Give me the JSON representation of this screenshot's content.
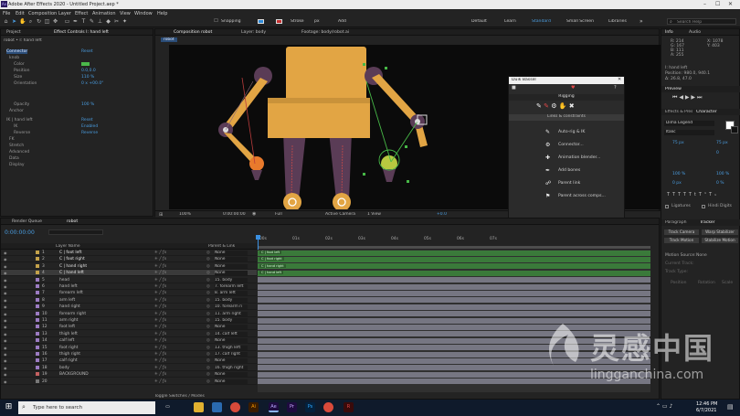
{
  "window": {
    "title": "Adobe After Effects 2020 - Untitled Project.aep *"
  },
  "menu": [
    "File",
    "Edit",
    "Composition",
    "Layer",
    "Effect",
    "Animation",
    "View",
    "Window",
    "Help"
  ],
  "toolbar": {
    "snapping": "Snapping",
    "stroke_label": "Stroke",
    "stroke_value": "px",
    "add_label": "Add",
    "workspaces": [
      "Default",
      "Learn",
      "Standard",
      "Small Screen",
      "Libraries"
    ],
    "search_placeholder": "Search Help"
  },
  "left_panel": {
    "tabs": [
      "Project",
      "Effect Controls I: hand left"
    ],
    "breadcrumb": "robot • I: hand left",
    "rows": [
      {
        "label": "Connector",
        "value": "Reset"
      },
      {
        "label": "knob",
        "value": ""
      },
      {
        "label": "Color",
        "value": ""
      },
      {
        "label": "Position",
        "value": "0.0,0.0"
      },
      {
        "label": "Size",
        "value": "110 %"
      },
      {
        "label": "Orientation",
        "value": "0 x +00.0°"
      },
      {
        "label": "Opacity",
        "value": "100 %"
      },
      {
        "label": "Anchor",
        "value": ""
      },
      {
        "label": "IK | hand left",
        "value": "Reset"
      },
      {
        "label": "IK",
        "value": "Enabled"
      },
      {
        "label": "Reverse",
        "value": "Reverse"
      },
      {
        "label": "FK",
        "value": ""
      },
      {
        "label": "Stretch",
        "value": ""
      },
      {
        "label": "Advanced",
        "value": ""
      },
      {
        "label": "Data",
        "value": ""
      },
      {
        "label": "Display",
        "value": ""
      }
    ]
  },
  "composition": {
    "tabs": [
      "Composition robot",
      "Layer: body",
      "Footage: body/robot.ai"
    ],
    "comp_name": "robot",
    "footer": {
      "zoom": "100%",
      "timecode": "0:00:00:00",
      "resolution": "Full",
      "camera": "Active Camera",
      "views": "1 View",
      "exposure": "+0.0"
    }
  },
  "duik": {
    "title": "Duik Bassel",
    "section": "Rigging",
    "subsection": "Links & constraints",
    "items": [
      "Auto-rig & IK",
      "Connector...",
      "Animation blender...",
      "Add bones",
      "Parent link",
      "Parent across comps..."
    ],
    "footer": "Write/parent/comp"
  },
  "info_panel": {
    "tabs": [
      "Info",
      "Audio"
    ],
    "lines": [
      "R: 214",
      "G: 167",
      "B: 111",
      "A: 255",
      "X: 1078",
      "Y: 403"
    ],
    "layer": "I: hand left",
    "position": "Position: 980.0, 940.1",
    "delta": "Δ: 26.8, 47.0"
  },
  "preview_panel": {
    "title": "Preview"
  },
  "character_panel": {
    "tabs": [
      "Effects & Presets",
      "Character"
    ],
    "font": "Dima Legend",
    "style": "Italic",
    "size": "75 px",
    "leading": "75 px",
    "tracking": "0",
    "scale_v": "100 %",
    "scale_h": "100 %",
    "baseline": "0 px",
    "tsume": "0 %",
    "checkbox_ligatures": "Ligatures",
    "checkbox_hindi": "Hindi Digits"
  },
  "paragraph_panel": {
    "tabs": [
      "Paragraph",
      "Tracker"
    ],
    "motion_source": "Motion Source:",
    "motion_source_value": "None",
    "current_track": "Current Track:",
    "track_type": "Track Type:",
    "buttons": [
      "Track Camera",
      "Warp Stabilizer",
      "Track Motion",
      "Stabilize Motion"
    ],
    "checks": [
      "Position",
      "Rotation",
      "Scale"
    ]
  },
  "timeline": {
    "tabs": [
      "Render Queue",
      "robot"
    ],
    "timecode": "0:00:00:00",
    "columns": [
      "Layer Name",
      "Parent & Link"
    ],
    "ruler": [
      "00s",
      "01s",
      "02s",
      "03s",
      "04s",
      "05s",
      "06s",
      "07s"
    ],
    "footer": "Toggle Switches / Modes",
    "layers": [
      {
        "num": "1",
        "name": "C | foot left",
        "parent": "None",
        "color": "#c4a24a",
        "track_color": "#3a7a3a"
      },
      {
        "num": "2",
        "name": "C | foot right",
        "parent": "None",
        "color": "#c4a24a",
        "track_color": "#3a7a3a"
      },
      {
        "num": "3",
        "name": "C | hand right",
        "parent": "None",
        "color": "#c4a24a",
        "track_color": "#3a7a3a"
      },
      {
        "num": "4",
        "name": "C | hand left",
        "parent": "None",
        "color": "#c4a24a",
        "track_color": "#3a7a3a"
      },
      {
        "num": "5",
        "name": "head",
        "parent": "15. body",
        "color": "#9b7bc2",
        "track_color": "#767682"
      },
      {
        "num": "6",
        "name": "hand left",
        "parent": "7. forearm left",
        "color": "#9b7bc2",
        "track_color": "#767682"
      },
      {
        "num": "7",
        "name": "forearm left",
        "parent": "8. arm left",
        "color": "#9b7bc2",
        "track_color": "#767682"
      },
      {
        "num": "8",
        "name": "arm left",
        "parent": "15. body",
        "color": "#9b7bc2",
        "track_color": "#767682"
      },
      {
        "num": "9",
        "name": "hand right",
        "parent": "10. forearm ri",
        "color": "#9b7bc2",
        "track_color": "#767682"
      },
      {
        "num": "10",
        "name": "forearm right",
        "parent": "11. arm right",
        "color": "#9b7bc2",
        "track_color": "#767682"
      },
      {
        "num": "11",
        "name": "arm right",
        "parent": "15. body",
        "color": "#9b7bc2",
        "track_color": "#767682"
      },
      {
        "num": "12",
        "name": "foot left",
        "parent": "None",
        "color": "#9b7bc2",
        "track_color": "#767682"
      },
      {
        "num": "13",
        "name": "thigh left",
        "parent": "14. calf left",
        "color": "#9b7bc2",
        "track_color": "#767682"
      },
      {
        "num": "14",
        "name": "calf left",
        "parent": "None",
        "color": "#9b7bc2",
        "track_color": "#767682"
      },
      {
        "num": "15",
        "name": "foot right",
        "parent": "13. thigh left",
        "color": "#9b7bc2",
        "track_color": "#767682"
      },
      {
        "num": "16",
        "name": "thigh right",
        "parent": "17. calf right",
        "color": "#9b7bc2",
        "track_color": "#767682"
      },
      {
        "num": "17",
        "name": "calf right",
        "parent": "None",
        "color": "#9b7bc2",
        "track_color": "#767682"
      },
      {
        "num": "18",
        "name": "body",
        "parent": "16. thigh right",
        "color": "#9b7bc2",
        "track_color": "#767682"
      },
      {
        "num": "19",
        "name": "BACKGROUND",
        "parent": "None",
        "color": "#c46060",
        "track_color": "#767682"
      },
      {
        "num": "20",
        "name": "",
        "parent": "None",
        "color": "#777777",
        "track_color": "#767682"
      }
    ]
  },
  "taskbar": {
    "search_placeholder": "Type here to search",
    "time": "12:46 PM",
    "date": "6/7/2021"
  },
  "watermark": {
    "brand_cn": "灵感中国",
    "url": "lingganchina.com"
  }
}
